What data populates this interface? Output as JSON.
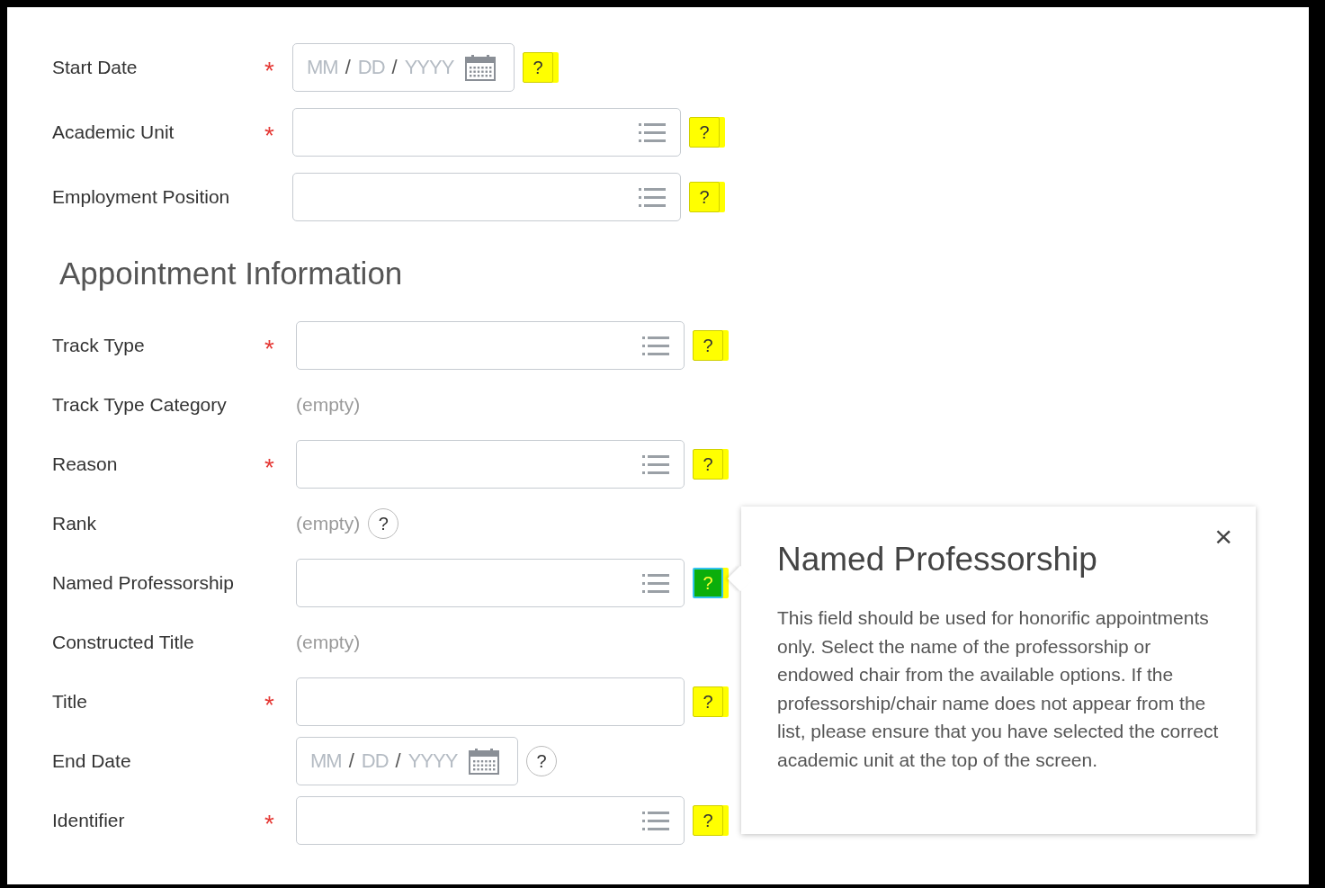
{
  "fields": [
    {
      "kind": "date",
      "label": "Start Date",
      "required": true,
      "parts": [
        {
          "kind": "hint",
          "text": "MM"
        },
        {
          "kind": "sep",
          "text": "/"
        },
        {
          "kind": "hint",
          "text": "DD"
        },
        {
          "kind": "sep",
          "text": "/"
        },
        {
          "kind": "hint",
          "text": "YYYY"
        }
      ],
      "help": {
        "symbol": "?",
        "highlighted": true,
        "active": false
      }
    },
    {
      "kind": "select",
      "label": "Academic Unit",
      "required": true,
      "help": {
        "symbol": "?",
        "highlighted": true,
        "active": false
      }
    },
    {
      "kind": "select",
      "label": "Employment Position",
      "required": false,
      "help": {
        "symbol": "?",
        "highlighted": true,
        "active": false
      }
    },
    {
      "kind": "heading",
      "label": "Appointment Information"
    },
    {
      "kind": "select",
      "label": "Track Type",
      "required": true,
      "help": {
        "symbol": "?",
        "highlighted": true,
        "active": false
      }
    },
    {
      "kind": "empty",
      "label": "Track Type Category",
      "value": "(empty)"
    },
    {
      "kind": "select",
      "label": "Reason",
      "required": true,
      "help": {
        "symbol": "?",
        "highlighted": true,
        "active": false
      }
    },
    {
      "kind": "empty",
      "label": "Rank",
      "value": "(empty)",
      "help": {
        "symbol": "?",
        "highlighted": false,
        "active": false
      }
    },
    {
      "kind": "select",
      "label": "Named Professorship",
      "required": false,
      "help": {
        "symbol": "?",
        "highlighted": true,
        "active": true
      }
    },
    {
      "kind": "empty",
      "label": "Constructed Title",
      "value": "(empty)"
    },
    {
      "kind": "text",
      "label": "Title",
      "required": true,
      "help": {
        "symbol": "?",
        "highlighted": true,
        "active": false
      }
    },
    {
      "kind": "date",
      "label": "End Date",
      "required": false,
      "parts": [
        {
          "kind": "hint",
          "text": "MM"
        },
        {
          "kind": "sep",
          "text": "/"
        },
        {
          "kind": "hint",
          "text": "DD"
        },
        {
          "kind": "sep",
          "text": "/"
        },
        {
          "kind": "hint",
          "text": "YYYY"
        }
      ],
      "help": {
        "symbol": "?",
        "highlighted": false,
        "active": false
      }
    },
    {
      "kind": "select",
      "label": "Identifier",
      "required": true,
      "help": {
        "symbol": "?",
        "highlighted": true,
        "active": false
      }
    }
  ],
  "required_mark": "*",
  "popover": {
    "title": "Named Professorship",
    "close": "×",
    "body": "This field should be used for honorific appointments only. Select the name of the professorship or endowed chair from the available options. If the professorship/chair name does not appear from the list, please ensure that you have selected the correct academic unit at the top of the screen."
  }
}
